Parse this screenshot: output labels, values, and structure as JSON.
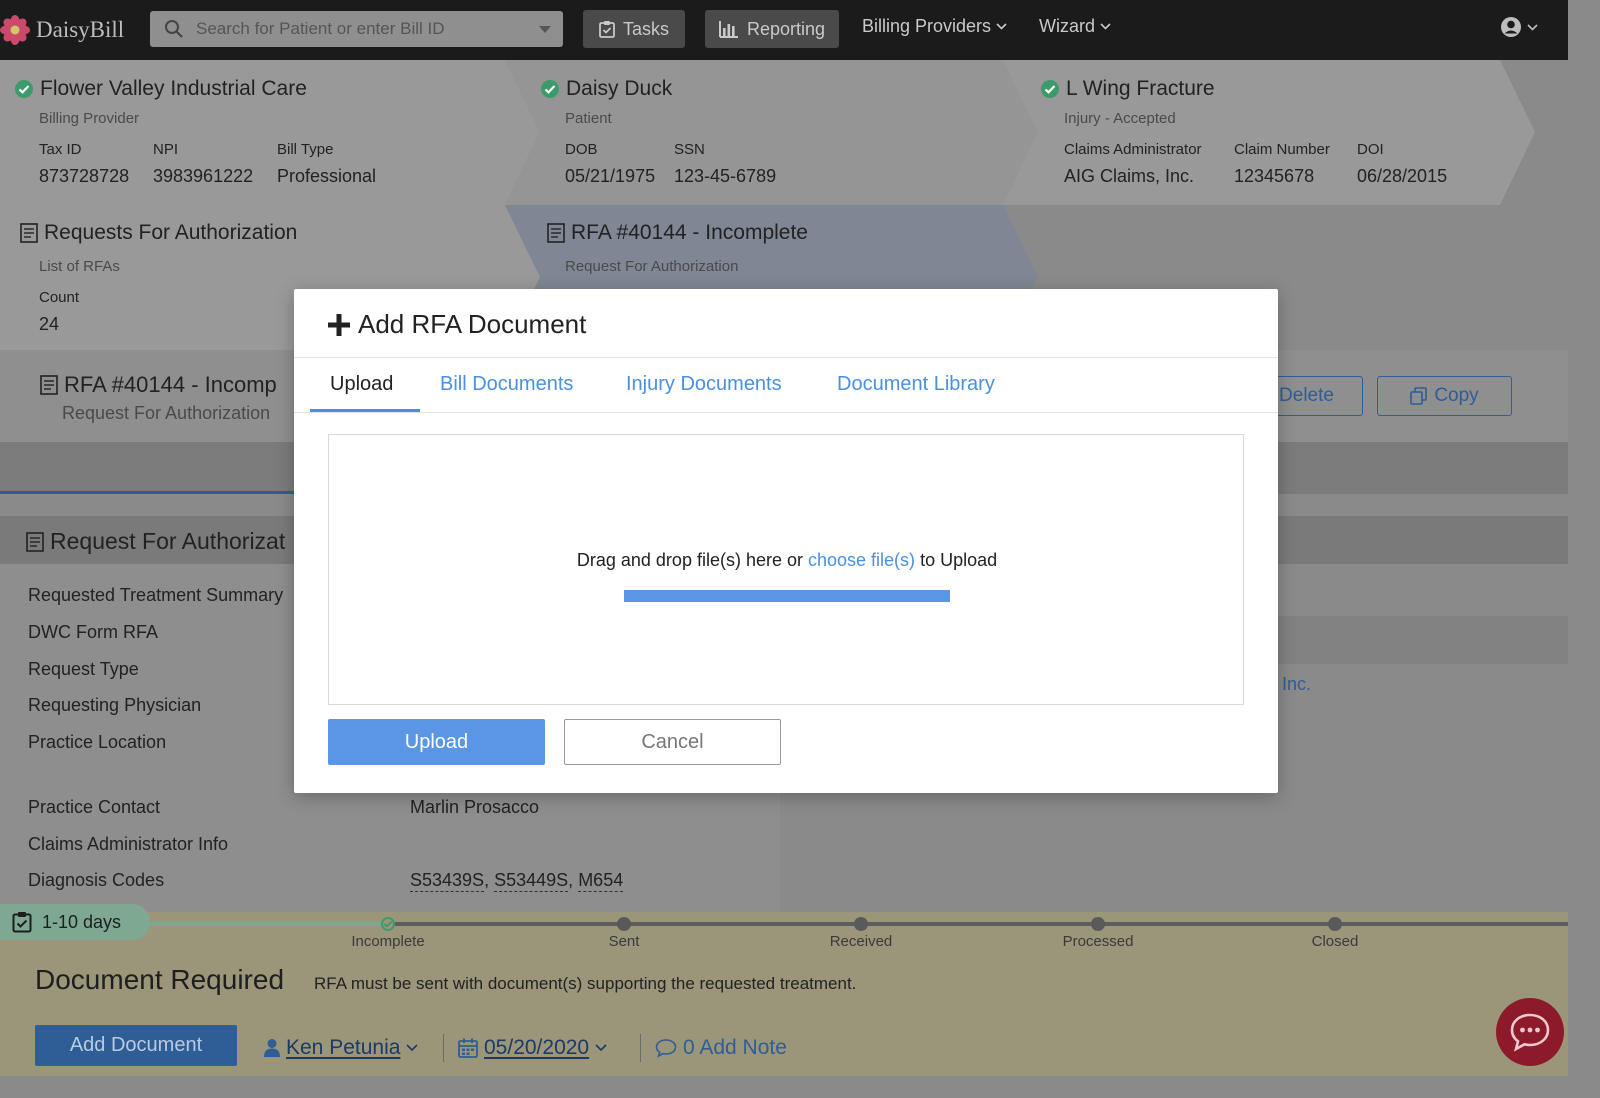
{
  "nav": {
    "brand": "DaisyBill",
    "search_placeholder": "Search for Patient or enter Bill ID",
    "tasks": "Tasks",
    "reporting": "Reporting",
    "billing_providers": "Billing Providers",
    "wizard": "Wizard",
    "icons": [
      "flower-icon",
      "search-icon",
      "clipboard-check-icon",
      "bar-chart-icon",
      "user-circle-icon",
      "chevron-down-icon"
    ]
  },
  "header": {
    "provider": {
      "title": "Flower Valley Industrial Care",
      "subtitle": "Billing Provider",
      "fields": [
        {
          "label": "Tax ID",
          "value": "873728728"
        },
        {
          "label": "NPI",
          "value": "3983961222"
        },
        {
          "label": "Bill Type",
          "value": "Professional"
        }
      ]
    },
    "patient": {
      "title": "Daisy Duck",
      "subtitle": "Patient",
      "fields": [
        {
          "label": "DOB",
          "value": "05/21/1975"
        },
        {
          "label": "SSN",
          "value": "123-45-6789"
        }
      ]
    },
    "injury": {
      "title": "L Wing Fracture",
      "subtitle": "Injury - Accepted",
      "fields": [
        {
          "label": "Claims Administrator",
          "value": "AIG Claims, Inc."
        },
        {
          "label": "Claim Number",
          "value": "12345678"
        },
        {
          "label": "DOI",
          "value": "06/28/2015"
        }
      ]
    }
  },
  "rfa_list": {
    "title": "Requests For Authorization",
    "subtitle": "List of RFAs",
    "count_label": "Count",
    "count_value": "24"
  },
  "rfa_current": {
    "title": "RFA #40144 - Incomplete",
    "subtitle": "Request For Authorization"
  },
  "rfa_row": {
    "title": "RFA #40144 - Incomp",
    "subtitle": "Request For Authorization",
    "delete_label": "Delete",
    "copy_label": "Copy"
  },
  "section": {
    "title": "Request For Authorizat",
    "rows": [
      {
        "label": "Requested Treatment Summary",
        "value": ""
      },
      {
        "label": "DWC Form RFA",
        "value": ""
      },
      {
        "label": "Request Type",
        "value": ""
      },
      {
        "label": "Requesting Physician",
        "value": ""
      },
      {
        "label": "Practice Location",
        "value": ""
      },
      {
        "label": "Practice Contact",
        "value": "Marlin Prosacco"
      },
      {
        "label": "Claims Administrator Info",
        "value": ""
      },
      {
        "label": "Diagnosis Codes",
        "value": ""
      }
    ],
    "diagnosis_codes": [
      "S53439S",
      "S53449S",
      "M654"
    ],
    "right_partial": ", Inc."
  },
  "status": {
    "days": "1-10 days",
    "steps": [
      "Incomplete",
      "Sent",
      "Received",
      "Processed",
      "Closed"
    ],
    "current_step": 0,
    "headline": "Document Required",
    "message": "RFA must be sent with document(s) supporting the requested treatment.",
    "add_document": "Add Document",
    "assignee": "Ken Petunia",
    "date": "05/20/2020",
    "note": "0 Add Note"
  },
  "modal": {
    "title": "Add RFA Document",
    "tabs": [
      {
        "label": "Upload",
        "active": true
      },
      {
        "label": "Bill Documents",
        "active": false
      },
      {
        "label": "Injury Documents",
        "active": false
      },
      {
        "label": "Document Library",
        "active": false
      }
    ],
    "drop_text_before": "Drag and drop file(s) here or",
    "drop_link": "choose file(s)",
    "drop_text_after": "to Upload",
    "progress": 1.0,
    "upload": "Upload",
    "cancel": "Cancel"
  },
  "colors": {
    "accent": "#4a90e2",
    "primary_button": "#5a96e3",
    "nav_bg": "#1b1b1b",
    "success": "#3c9b6a",
    "chat": "#8c1a2a"
  }
}
